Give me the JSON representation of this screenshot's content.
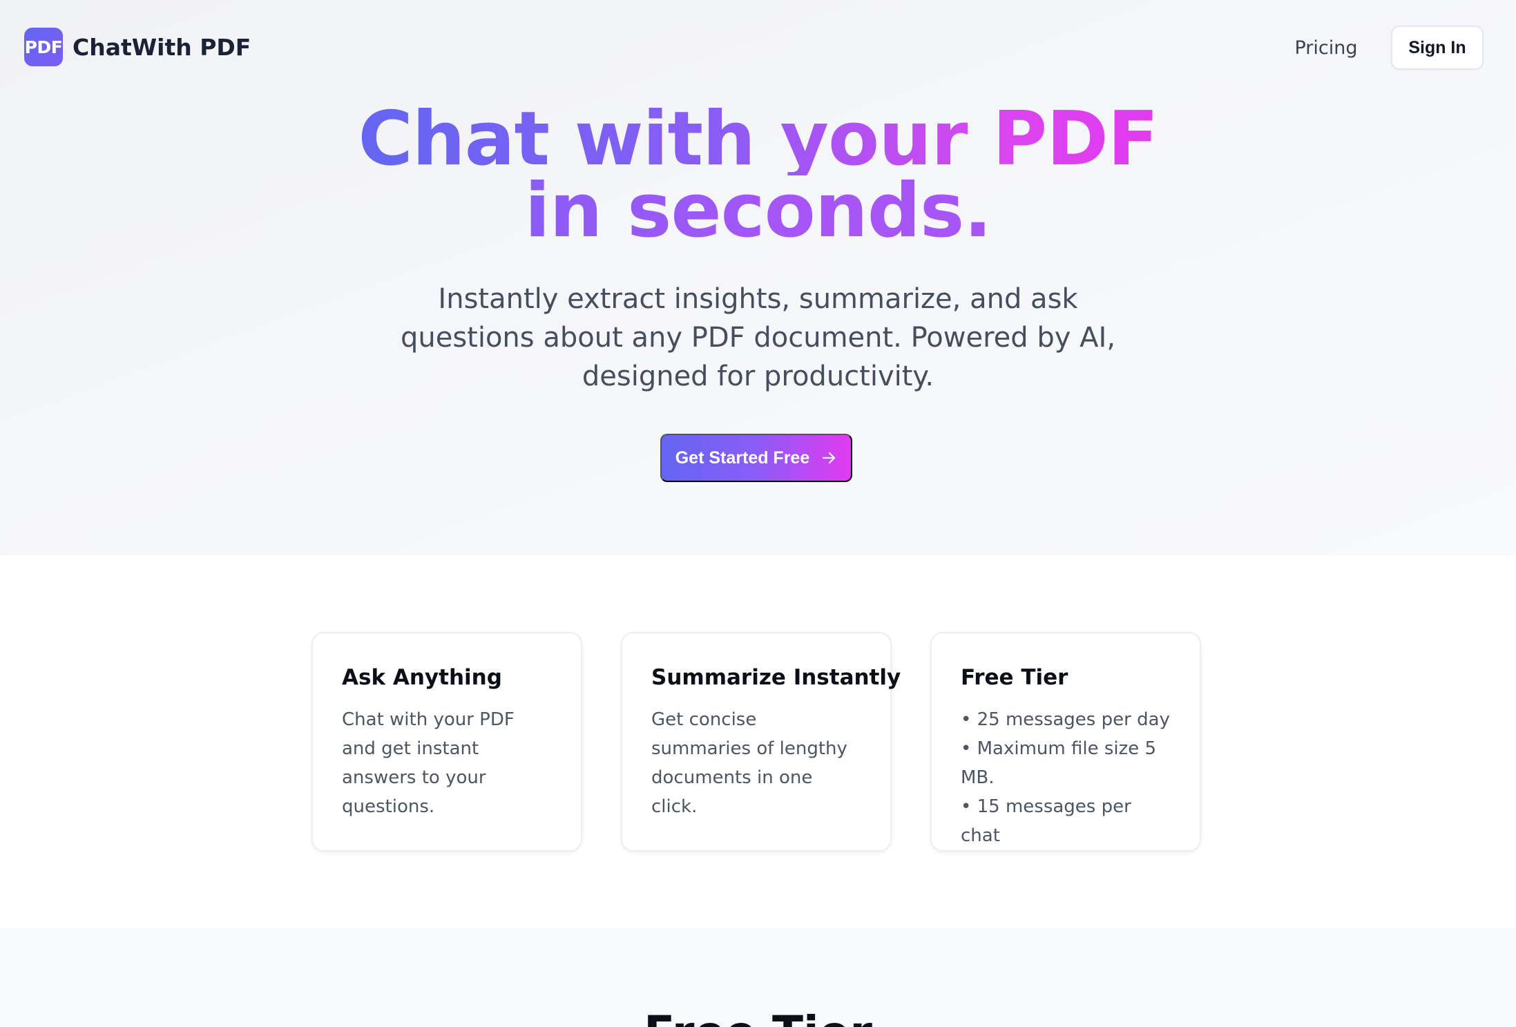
{
  "nav": {
    "logo_text": "PDF",
    "brand": "ChatWith PDF",
    "pricing": "Pricing",
    "sign_in": "Sign In"
  },
  "hero": {
    "headline_line1": "Chat with your PDF",
    "headline_line2": "in seconds.",
    "subtitle": "Instantly extract insights, summarize, and ask questions about any PDF document. Powered by AI, designed for productivity.",
    "cta_label": "Get Started Free",
    "cta_icon": "arrow-right-icon",
    "gradient_colors": [
      "#6366f1",
      "#8b5cf6",
      "#d946ef"
    ]
  },
  "features": [
    {
      "title": "Ask Anything",
      "body": "Chat with your PDF and get instant answers to your questions."
    },
    {
      "title": "Summarize Instantly",
      "body": "Get concise summaries of lengthy documents in one click."
    },
    {
      "title": "Free Tier",
      "items": [
        "25 messages per day",
        "Maximum file size 5 MB.",
        "15 messages per chat"
      ]
    }
  ],
  "tier_section": {
    "title": "Free Tier"
  }
}
